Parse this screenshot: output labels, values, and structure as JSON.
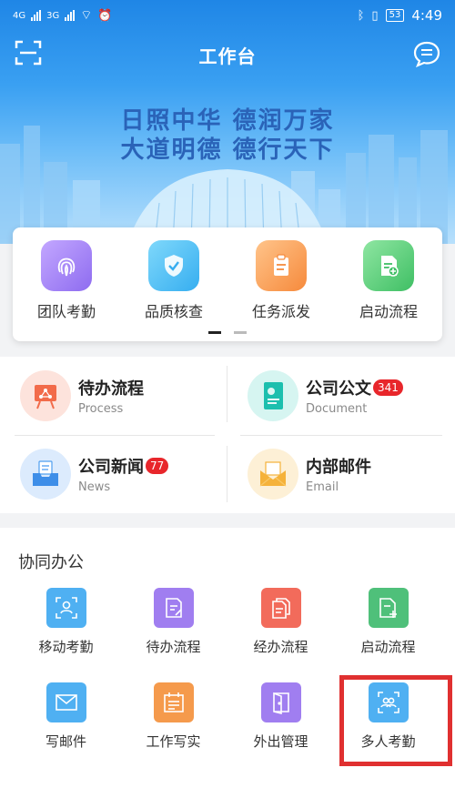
{
  "status": {
    "network1": "4G",
    "network2": "3G",
    "battery": "53",
    "time": "4:49"
  },
  "header": {
    "title": "工作台"
  },
  "banner": {
    "line1": "日照中华  德润万家",
    "line2": "大道明德  德行天下"
  },
  "quick_tiles": [
    {
      "label": "团队考勤",
      "icon": "fingerprint-icon",
      "color": "#a78bfa"
    },
    {
      "label": "品质核查",
      "icon": "shield-check-icon",
      "color": "#5bc8f5"
    },
    {
      "label": "任务派发",
      "icon": "clipboard-icon",
      "color": "#f8a35a"
    },
    {
      "label": "启动流程",
      "icon": "document-add-icon",
      "color": "#5fd27a"
    }
  ],
  "features": [
    {
      "title": "待办流程",
      "subtitle": "Process",
      "badge": "",
      "icon": "presentation-board-icon"
    },
    {
      "title": "公司公文",
      "subtitle": "Document",
      "badge": "341",
      "icon": "document-book-icon"
    },
    {
      "title": "公司新闻",
      "subtitle": "News",
      "badge": "77",
      "icon": "inbox-tray-icon"
    },
    {
      "title": "内部邮件",
      "subtitle": "Email",
      "badge": "",
      "icon": "envelope-icon"
    }
  ],
  "collab": {
    "title": "协同办公",
    "items": [
      {
        "label": "移动考勤",
        "icon": "person-scan-icon",
        "color": "#4fb0f2"
      },
      {
        "label": "待办流程",
        "icon": "document-edit-icon",
        "color": "#a07ef0"
      },
      {
        "label": "经办流程",
        "icon": "documents-icon",
        "color": "#f26b5b"
      },
      {
        "label": "启动流程",
        "icon": "document-plus-icon",
        "color": "#4fc07a"
      },
      {
        "label": "写邮件",
        "icon": "mail-icon",
        "color": "#4fb0f2"
      },
      {
        "label": "工作写实",
        "icon": "calendar-list-icon",
        "color": "#f59a4c"
      },
      {
        "label": "外出管理",
        "icon": "door-exit-icon",
        "color": "#a07ef0"
      },
      {
        "label": "多人考勤",
        "icon": "group-scan-icon",
        "color": "#4fb0f2"
      }
    ]
  }
}
